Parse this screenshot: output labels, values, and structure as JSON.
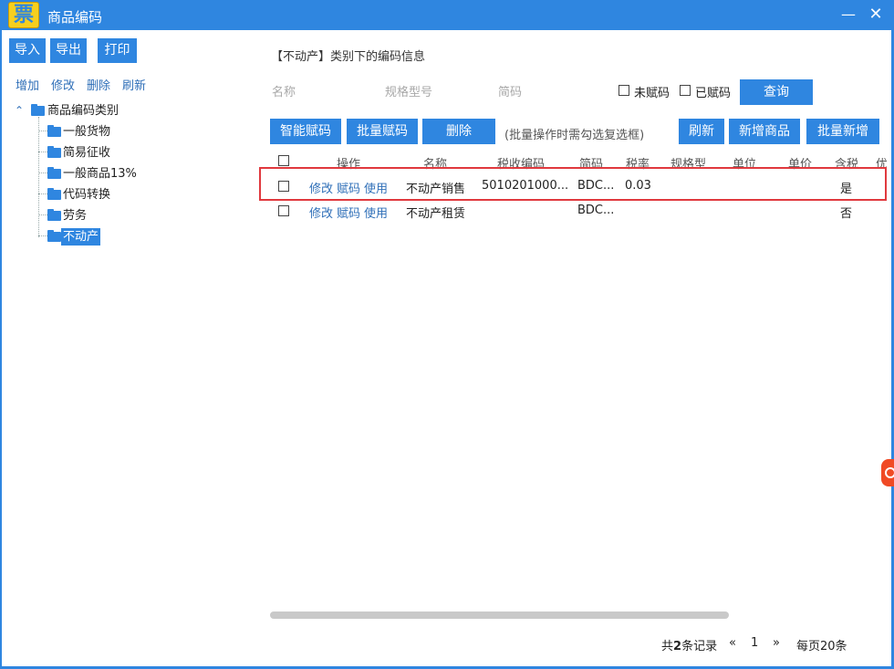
{
  "app": {
    "logo_text": "票",
    "title": "商品编码",
    "min_symbol": "—",
    "close_symbol": "✕"
  },
  "toolbar": {
    "import_label": "导入",
    "export_label": "导出",
    "print_label": "打印"
  },
  "tree_actions": {
    "add": "增加",
    "edit": "修改",
    "delete": "删除",
    "refresh": "刷新"
  },
  "tree": {
    "toggle": "⌃",
    "root": "商品编码类别",
    "children": [
      "一般货物",
      "简易征收",
      "一般商品13%",
      "代码转换",
      "劳务",
      "不动产"
    ],
    "selected": "不动产"
  },
  "main": {
    "section_title": "【不动产】类别下的编码信息"
  },
  "filters": {
    "name_placeholder": "名称",
    "spec_placeholder": "规格型号",
    "short_placeholder": "简码",
    "uncoded_label": "未赋码",
    "coded_label": "已赋码",
    "query_label": "查询"
  },
  "actions": {
    "smart_code": "智能赋码",
    "batch_code": "批量赋码",
    "delete": "删除",
    "hint": "(批量操作时需勾选复选框)",
    "refresh": "刷新",
    "add_goods": "新增商品",
    "batch_add": "批量新增"
  },
  "table": {
    "headers": {
      "op": "操作",
      "name": "名称",
      "tax_code": "税收编码",
      "short": "简码",
      "rate": "税率",
      "spec": "规格型",
      "unit": "单位",
      "price": "单价",
      "tax_incl": "含税",
      "overflow": "优"
    },
    "rows": [
      {
        "op_edit": "修改",
        "op_code": "赋码",
        "op_use": "使用",
        "name": "不动产销售",
        "tax_code": "5010201000...",
        "short": "BDC...",
        "rate": "0.03",
        "spec": "",
        "unit": "",
        "price": "",
        "tax_incl": "是"
      },
      {
        "op_edit": "修改",
        "op_code": "赋码",
        "op_use": "使用",
        "name": "不动产租赁",
        "tax_code": "",
        "short": "BDC...",
        "rate": "",
        "spec": "",
        "unit": "",
        "price": "",
        "tax_incl": "否"
      }
    ]
  },
  "pager": {
    "total_prefix": "共",
    "total_count": "2",
    "total_suffix": "条记录",
    "prev": "«",
    "page": "1",
    "next": "»",
    "per_page": "每页20条"
  },
  "colors": {
    "accent": "#2f86e0",
    "highlight_border": "#e0393e",
    "link": "#2f6fb8",
    "logo": "#f6cf1e"
  }
}
